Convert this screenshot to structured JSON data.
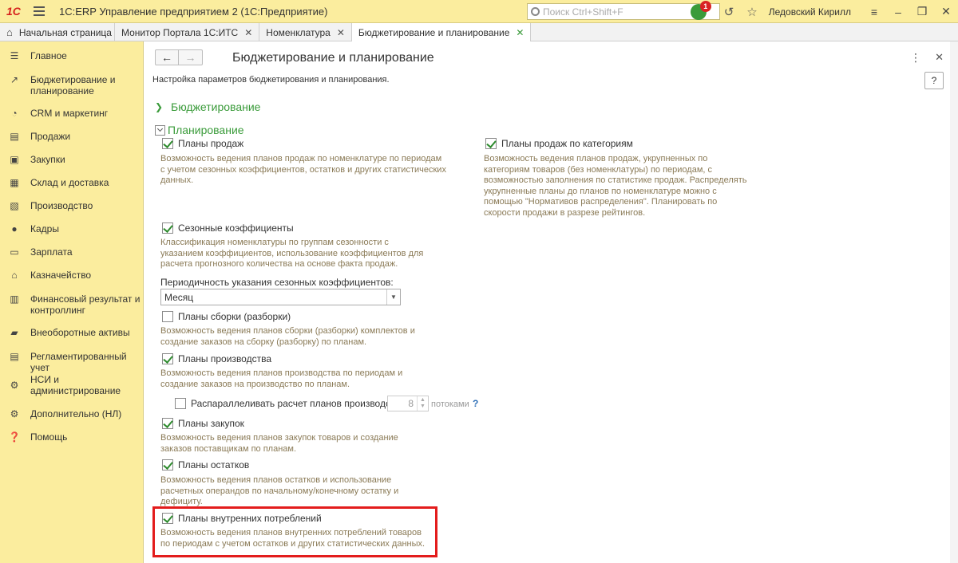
{
  "titlebar": {
    "logo": "1С",
    "app_title": "1С:ERP Управление предприятием 2  (1С:Предприятие)",
    "search_placeholder": "Поиск Ctrl+Shift+F",
    "notifications_count": "1",
    "user": "Ледовский Кирилл"
  },
  "tabs": {
    "home": "Начальная страница",
    "items": [
      {
        "label": "Монитор Портала 1С:ИТС"
      },
      {
        "label": "Номенклатура"
      },
      {
        "label": "Бюджетирование и планирование"
      }
    ]
  },
  "sidebar": {
    "items": [
      {
        "label": "Главное",
        "icon": "menu-icon"
      },
      {
        "label": "Бюджетирование и планирование",
        "icon": "chart-icon"
      },
      {
        "label": "CRM и маркетинг",
        "icon": "pie-icon"
      },
      {
        "label": "Продажи",
        "icon": "cart-icon"
      },
      {
        "label": "Закупки",
        "icon": "truck-icon"
      },
      {
        "label": "Склад и доставка",
        "icon": "warehouse-icon"
      },
      {
        "label": "Производство",
        "icon": "factory-icon"
      },
      {
        "label": "Кадры",
        "icon": "person-icon"
      },
      {
        "label": "Зарплата",
        "icon": "money-icon"
      },
      {
        "label": "Казначейство",
        "icon": "bank-icon"
      },
      {
        "label": "Финансовый результат и контроллинг",
        "icon": "finance-icon"
      },
      {
        "label": "Внеоборотные активы",
        "icon": "assets-icon"
      },
      {
        "label": "Регламентированный учет",
        "icon": "ledger-icon"
      },
      {
        "label": "НСИ и администрирование",
        "icon": "gear-icon"
      },
      {
        "label": "Дополнительно (НЛ)",
        "icon": "cog-icon"
      },
      {
        "label": "Помощь",
        "icon": "help-icon"
      }
    ]
  },
  "main": {
    "title": "Бюджетирование и планирование",
    "subtitle": "Настройка параметров бюджетирования и планирования.",
    "help": "?",
    "group_budget": "Бюджетирование",
    "group_planning": "Планирование",
    "sales_plans": {
      "label": "Планы продаж",
      "checked": true,
      "desc": "Возможность ведения планов продаж по номенклатуре по периодам с учетом сезонных коэффициентов, остатков и других статистических данных."
    },
    "sales_by_category": {
      "label": "Планы продаж по категориям",
      "checked": true,
      "desc": "Возможность ведения планов продаж, укрупненных по категориям товаров (без номенклатуры) по периодам, с возможностью заполнения по статистике продаж. Распределять укрупненные планы до планов по номенклатуре можно с помощью \"Нормативов распределения\". Планировать по скорости продажи в разрезе рейтингов."
    },
    "seasonal": {
      "label": "Сезонные коэффициенты",
      "checked": true,
      "desc": "Классификация номенклатуры по группам сезонности с указанием коэффициентов, использование коэффициентов для расчета прогнозного количества на основе факта продаж."
    },
    "periodicity": {
      "label": "Периодичность указания сезонных коэффициентов:",
      "value": "Месяц"
    },
    "assembly": {
      "label": "Планы сборки (разборки)",
      "checked": false,
      "desc": "Возможность ведения планов сборки (разборки) комплектов и создание заказов на сборку (разборку) по планам."
    },
    "production": {
      "label": "Планы производства",
      "checked": true,
      "desc": "Возможность ведения планов производства по периодам и создание заказов на производство по планам."
    },
    "parallel": {
      "label": "Распараллеливать расчет планов производства",
      "checked": false,
      "threads": "8",
      "threads_suffix": "потоками",
      "help": "?"
    },
    "purchase": {
      "label": "Планы закупок",
      "checked": true,
      "desc": "Возможность ведения планов закупок товаров и создание заказов поставщикам по планам."
    },
    "stock": {
      "label": "Планы остатков",
      "checked": true,
      "desc": "Возможность ведения планов остатков и использование расчетных операндов по начальному/конечному остатку и дефициту."
    },
    "internal": {
      "label": "Планы внутренних потреблений",
      "checked": true,
      "desc": "Возможность ведения планов внутренних потреблений товаров по периодам с учетом остатков и других статистических данных."
    }
  }
}
